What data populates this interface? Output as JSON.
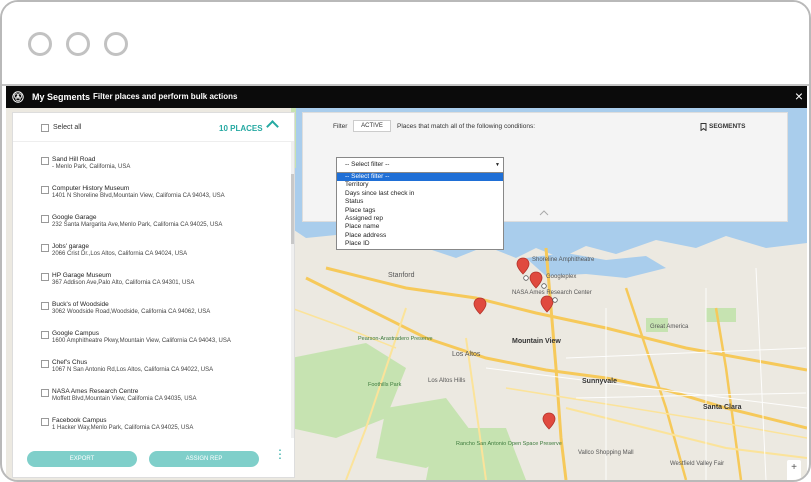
{
  "app": {
    "title": "My Segments",
    "subtitle": "Filter places and perform bulk actions",
    "close": "×"
  },
  "panel": {
    "select_all": "Select all",
    "count": "10 PLACES",
    "items": [
      {
        "name": "Sand Hill Road",
        "address": "- Menlo Park, California, USA"
      },
      {
        "name": "Computer History Museum",
        "address": "1401 N Shoreline Blvd,Mountain View, California CA 94043, USA"
      },
      {
        "name": "Google Garage",
        "address": "232 Santa Margarita Ave,Menlo Park, California CA 94025, USA"
      },
      {
        "name": "Jobs' garage",
        "address": "2066 Crist Dr.,Los Altos, California CA 94024, USA"
      },
      {
        "name": "HP Garage Museum",
        "address": "367 Addison Ave,Palo Alto, California CA 94301, USA"
      },
      {
        "name": "Buck's of Woodside",
        "address": "3062 Woodside Road,Woodside, California CA 94062, USA"
      },
      {
        "name": "Google Campus",
        "address": "1600 Amphitheatre Pkwy,Mountain View, California CA 94043, USA"
      },
      {
        "name": "Chef's Chus",
        "address": "1067 N San Antonio Rd,Los Altos, California CA 94022, USA"
      },
      {
        "name": "NASA Ames Research Centre",
        "address": "Moffett Blvd,Mountain View, California CA 94035, USA"
      },
      {
        "name": "Facebook Campus",
        "address": "1 Hacker Way,Menlo Park, California CA 94025, USA"
      }
    ],
    "export_label": "EXPORT",
    "assign_label": "ASSIGN REP",
    "kebab": "⋮"
  },
  "filter": {
    "filter_label": "Filter",
    "status_value": "ACTIVE",
    "conditions_text": "Places that match all of the following conditions:",
    "segments_label": "SEGMENTS",
    "select_value": "-- Select filter --",
    "options": [
      "-- Select filter --",
      "Territory",
      "Days since last check in",
      "Status",
      "Place tags",
      "Assigned rep",
      "Place name",
      "Place address",
      "Place ID"
    ]
  },
  "map": {
    "labels": {
      "stanford": "Stanford",
      "los_altos": "Los Altos",
      "los_altos_hills": "Los Altos Hills",
      "mountain_view": "Mountain View",
      "sunnyvale": "Sunnyvale",
      "santa_clara": "Santa Clara",
      "great_america": "Great America",
      "shoreline": "Shoreline Amphitheatre",
      "googleplex": "Googleplex",
      "nasa": "NASA Ames Research Center",
      "pearson": "Pearson-Arastradero Preserve",
      "foothills": "Foothills Park",
      "rancho": "Rancho San Antonio Open Space Preserve",
      "vallco": "Vallco Shopping Mall",
      "westfield": "Westfield Valley Fair"
    },
    "zoom_in": "+",
    "zoom_out": "−"
  },
  "colors": {
    "accent": "#25a9a2",
    "button": "#7fcfca",
    "pin": "#e04a3f",
    "water": "#a9cdec",
    "park": "#c6e3b1"
  }
}
